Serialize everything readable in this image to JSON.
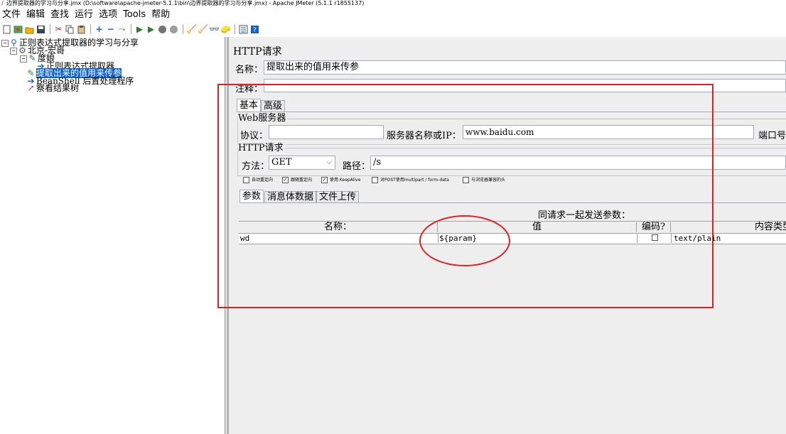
{
  "window": {
    "title": "边界提取器的学习与分享.jmx (D:\\software\\apache-jmeter-5.1.1\\bin\\边界提取器的学习与分享.jmx) - Apache JMeter (5.1.1 r1855137)"
  },
  "menu": [
    "文件",
    "编辑",
    "查找",
    "运行",
    "选项",
    "Tools",
    "帮助"
  ],
  "toolbar": {
    "icons": [
      "new-icon",
      "templates-icon",
      "open-icon",
      "save-icon",
      "cut-icon",
      "copy-icon",
      "paste-icon",
      "expand-icon",
      "collapse-icon",
      "toggle-icon",
      "start-icon",
      "start-no-timers-icon",
      "stop-icon",
      "shutdown-icon",
      "clear-icon",
      "clear-all-icon",
      "search-icon",
      "reset-search-icon",
      "function-helper-icon",
      "help-icon"
    ]
  },
  "tree": {
    "root": "正则表达式提取器的学习与分享",
    "thread_group": "北京-宏哥",
    "sampler_1": "度娘",
    "extractor": "正则表达式提取器",
    "sampler_2": "提取出来的值用来传参",
    "postprocessor": "BeanShell 后置处理程序",
    "listener": "察看结果树"
  },
  "panel": {
    "title": "HTTP请求",
    "name_label": "名称：",
    "name_value": "提取出来的值用来传参",
    "comment_label": "注释：",
    "tabs": [
      "基本",
      "高级"
    ],
    "web_server": {
      "legend": "Web服务器",
      "protocol_label": "协议：",
      "protocol_value": "",
      "server_label": "服务器名称或IP：",
      "server_value": "www.baidu.com",
      "port_label": "端口号"
    },
    "http_request": {
      "legend": "HTTP请求",
      "method_label": "方法：",
      "method_value": "GET",
      "path_label": "路径：",
      "path_value": "/s"
    },
    "checkboxes": [
      {
        "label": "自动重定向",
        "checked": false
      },
      {
        "label": "跟随重定向",
        "checked": true
      },
      {
        "label": "使用 KeepAlive",
        "checked": true
      },
      {
        "label": "对POST使用multipart / form-data",
        "checked": false
      },
      {
        "label": "与浏览器兼容的头",
        "checked": false
      }
    ],
    "sub_tabs": [
      "参数",
      "消息体数据",
      "文件上传"
    ],
    "params_caption": "同请求一起发送参数：",
    "params_table": {
      "columns": [
        "名称：",
        "值",
        "编码?",
        "内容类型"
      ],
      "rows": [
        {
          "name": "wd",
          "value": "${param}",
          "encode": false,
          "content_type": "text/plain"
        }
      ]
    }
  },
  "annotation_color": "#e02020"
}
